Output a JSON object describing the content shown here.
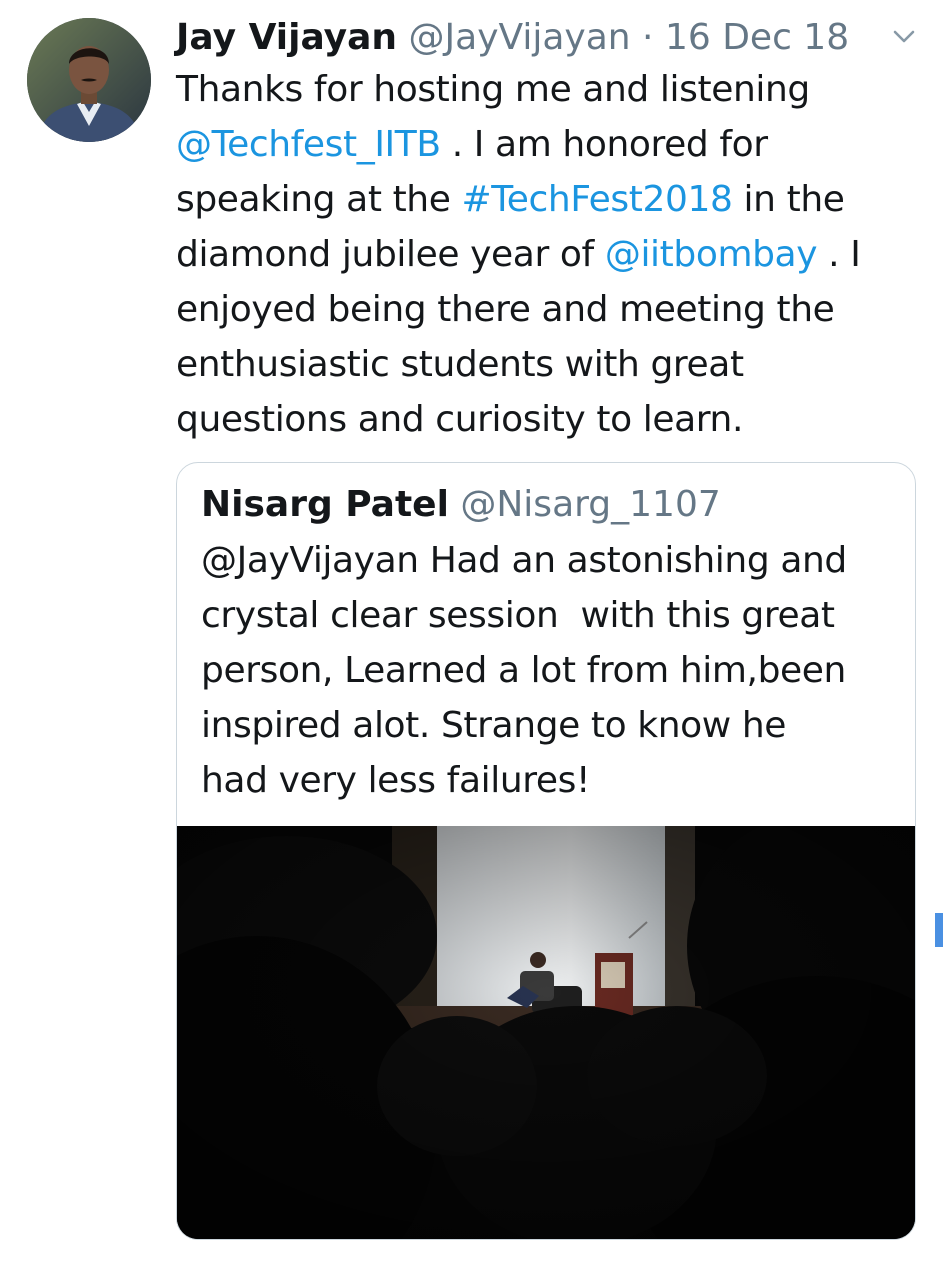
{
  "tweet": {
    "author_name": "Jay Vijayan",
    "author_handle": "@JayVijayan",
    "separator": "·",
    "date": "16 Dec 18",
    "body": {
      "line1": "Thanks for hosting me and listening",
      "line2_mention": "@Techfest_IITB",
      "line2_rest": " . I am honored for",
      "line3_pre": "speaking at the ",
      "line3_hashtag": "#TechFest2018",
      "line3_post": " in the",
      "line4_pre": "diamond jubilee year of ",
      "line4_mention": "@iitbombay",
      "line4_post": " . I",
      "line5": "enjoyed being there and meeting the",
      "line6": "enthusiastic students with great",
      "line7": "questions and curiosity to learn."
    }
  },
  "quoted_tweet": {
    "author_name": "Nisarg Patel",
    "author_handle": "@Nisarg_1107",
    "body_lines": [
      "@JayVijayan Had an astonishing and",
      "crystal clear session  with this great",
      "person, Learned a lot from him,been",
      "inspired alot. Strange to know he",
      "had very less failures!"
    ]
  },
  "icons": {
    "avatar": "profile-photo",
    "caret": "chevron-down-icon",
    "media": "auditorium-photo"
  },
  "colors": {
    "link": "#1b95e0",
    "muted": "#657786",
    "text": "#14171a",
    "border": "#ccd6dd"
  }
}
